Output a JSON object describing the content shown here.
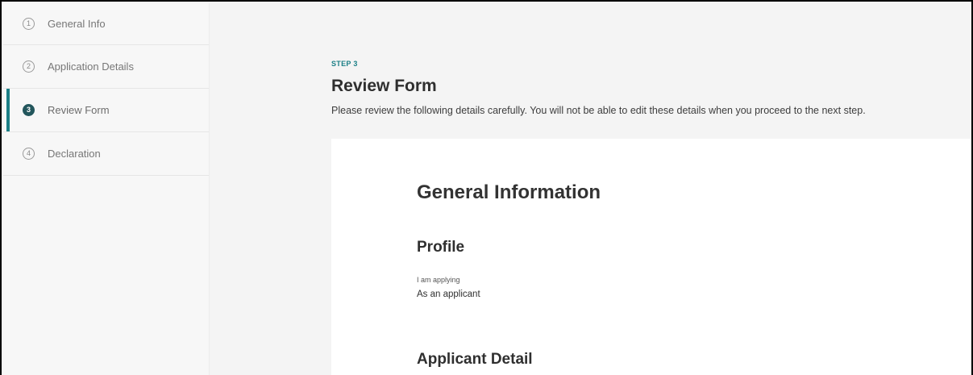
{
  "sidebar": {
    "steps": [
      {
        "number": "1",
        "label": "General Info",
        "state": "default"
      },
      {
        "number": "2",
        "label": "Application Details",
        "state": "default"
      },
      {
        "number": "3",
        "label": "Review Form",
        "state": "active"
      },
      {
        "number": "4",
        "label": "Declaration",
        "state": "default"
      }
    ],
    "active_accent_color": "#1b7f86",
    "active_badge_color": "#23565c"
  },
  "main": {
    "step_kicker": "STEP 3",
    "title": "Review Form",
    "description": "Please review the following details carefully. You will not be able to edit these details when you proceed to the next step."
  },
  "review": {
    "section_title": "General Information",
    "profile": {
      "title": "Profile",
      "field_label": "I am applying",
      "field_value": "As an applicant"
    },
    "applicant_detail_title": "Applicant Detail"
  }
}
